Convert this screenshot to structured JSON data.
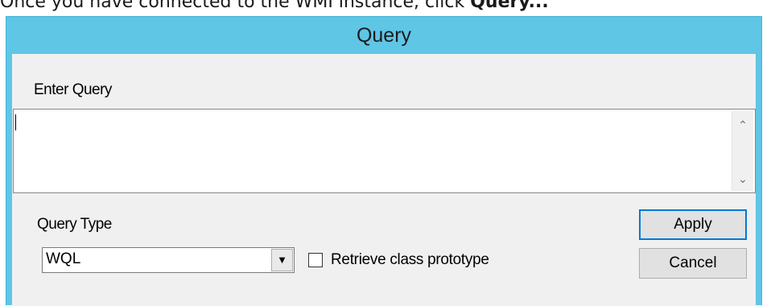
{
  "caption": {
    "text_before": "Once you have connected to the WMI instance, click ",
    "bold_text": "Query..."
  },
  "dialog": {
    "title": "Query",
    "enter_query_label": "Enter Query",
    "query_value": "",
    "query_type_label": "Query Type",
    "query_type_selected": "WQL",
    "retrieve_checkbox_label": "Retrieve class prototype",
    "retrieve_checked": false,
    "apply_label": "Apply",
    "cancel_label": "Cancel"
  },
  "icons": {
    "scroll_up": "chevron-up-icon",
    "scroll_down": "chevron-down-icon",
    "dropdown": "dropdown-arrow-icon"
  },
  "colors": {
    "titlebar": "#5fc6e6",
    "client_bg": "#f0f0f0",
    "default_button_border": "#0078d7"
  }
}
